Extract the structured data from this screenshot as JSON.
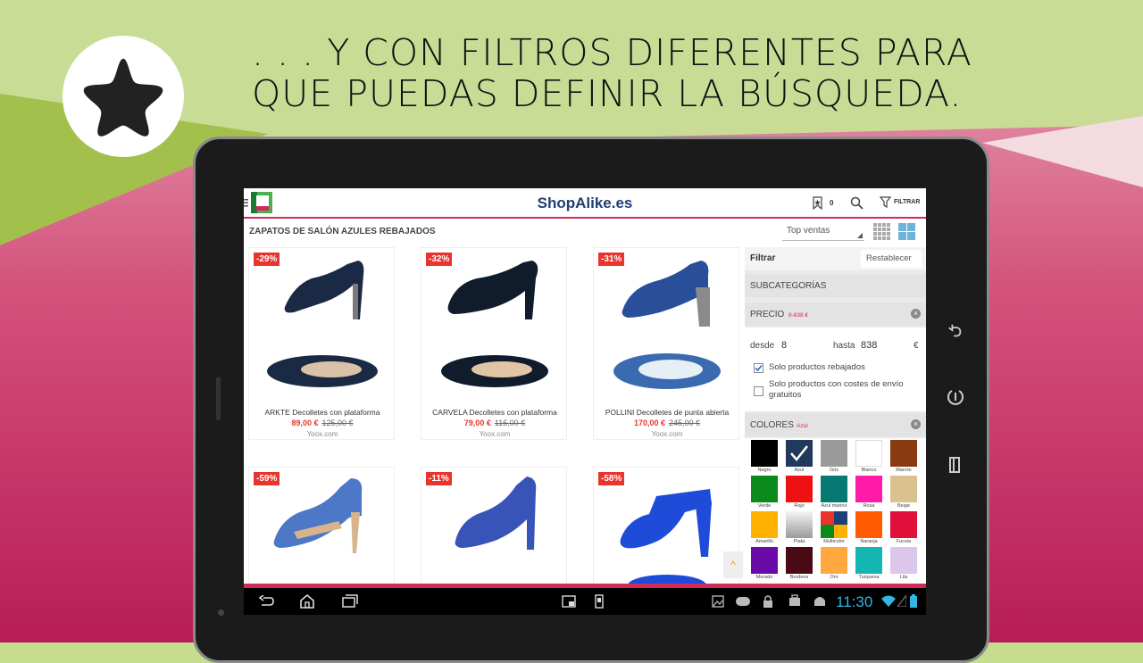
{
  "headline": {
    "line1": ". . . Y CON FILTROS DIFERENTES PARA",
    "line2": "QUE PUEDAS DEFINIR LA BÚSQUEDA."
  },
  "app": {
    "title": "ShopAlike.es",
    "bookmark_count": "0",
    "filter_label": "FILTRAR"
  },
  "listing": {
    "heading": "ZAPATOS DE SALÓN AZULES REBAJADOS",
    "sort_value": "Top ventas",
    "products": [
      {
        "badge": "-29%",
        "name": "ARKTE Decolletes con plataforma",
        "price": "89,00 €",
        "old_price": "125,00 €",
        "shop": "Yoox.com"
      },
      {
        "badge": "-32%",
        "name": "CARVELA Decolletes con plataforma",
        "price": "79,00 €",
        "old_price": "116,00 €",
        "shop": "Yoox.com"
      },
      {
        "badge": "-31%",
        "name": "POLLINI Decolletes de punta abierta",
        "price": "170,00 €",
        "old_price": "245,00 €",
        "shop": "Yoox.com"
      },
      {
        "badge": "-59%"
      },
      {
        "badge": "-11%"
      },
      {
        "badge": "-58%"
      }
    ]
  },
  "filters": {
    "title": "Filtrar",
    "reset": "Restablecer",
    "subcategories": "SUBCATEGORÍAS",
    "price": {
      "label": "PRECIO",
      "range": "8-838 €",
      "from_label": "desde",
      "from_value": "8",
      "to_label": "hasta",
      "to_value": "838",
      "currency": "€",
      "only_sale": "Solo productos rebajados",
      "only_sale_checked": true,
      "free_shipping": "Solo productos con costes de envío gratuitos",
      "free_shipping_checked": false
    },
    "colors": {
      "label": "COLORES",
      "selected": "Azul",
      "swatches": [
        {
          "name": "Negro",
          "hex": "#000000"
        },
        {
          "name": "Azul",
          "hex": "#1f3a5a",
          "selected": true
        },
        {
          "name": "Gris",
          "hex": "#9a9a9a"
        },
        {
          "name": "Blanco",
          "hex": "#ffffff"
        },
        {
          "name": "Marrón",
          "hex": "#8a3a10"
        },
        {
          "name": "Verde",
          "hex": "#0a8a1a"
        },
        {
          "name": "Rojo",
          "hex": "#ee1111"
        },
        {
          "name": "Azul marino",
          "hex": "#067a72"
        },
        {
          "name": "Rosa",
          "hex": "#ff1aa8"
        },
        {
          "name": "Beige",
          "hex": "#d9c28e"
        },
        {
          "name": "Amarillo",
          "hex": "#ffb000"
        },
        {
          "name": "Plata",
          "hex": "#c8c8c8"
        },
        {
          "name": "Multicolor",
          "hex": "multi"
        },
        {
          "name": "Naranja",
          "hex": "#ff5a00"
        },
        {
          "name": "Fucsia",
          "hex": "#e0103a"
        },
        {
          "name": "Morado",
          "hex": "#6a0aa8"
        },
        {
          "name": "Burdeos",
          "hex": "#4a0a14"
        },
        {
          "name": "Oro",
          "hex": "#ffa840"
        },
        {
          "name": "Turquesa",
          "hex": "#13b6b0"
        },
        {
          "name": "Lila",
          "hex": "#dcc6ec"
        }
      ]
    }
  },
  "system": {
    "clock": "11:30"
  }
}
